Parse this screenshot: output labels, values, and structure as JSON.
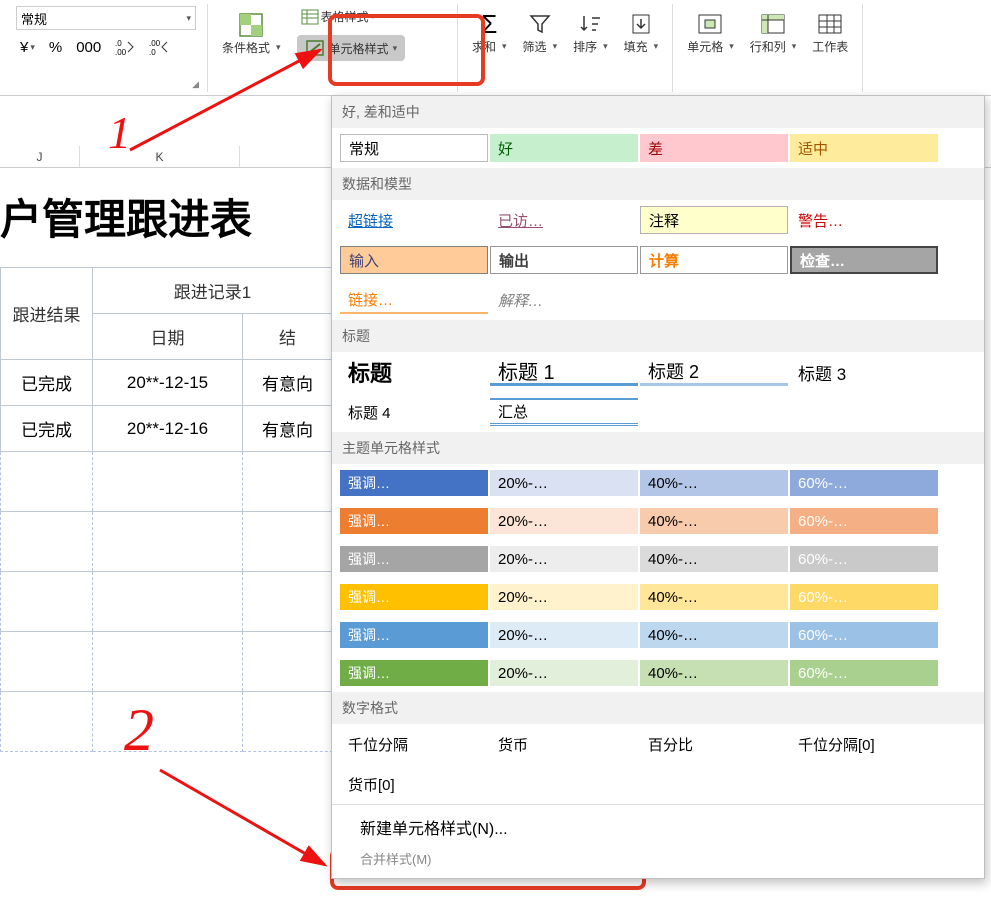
{
  "ribbon": {
    "number_format": "常规",
    "currency_btn": "¥",
    "percent_btn": "%",
    "thousand_btn": "000",
    "dec_inc": ".0 0",
    "dec_dec": ".00",
    "cond_format": "条件格式",
    "table_styles": "表格样式",
    "cell_styles": "单元格样式",
    "sum": "求和",
    "filter": "筛选",
    "sort": "排序",
    "fill": "填充",
    "cells": "单元格",
    "rowcol": "行和列",
    "worksheet": "工作表"
  },
  "columns": {
    "j": "J",
    "k": "K"
  },
  "sheet": {
    "title": "户管理跟进表",
    "headers": {
      "result": "跟进结果",
      "record": "跟进记录1",
      "date": "日期",
      "detail": "结"
    },
    "rows": [
      {
        "result": "已完成",
        "date": "20**-12-15",
        "detail": "有意向"
      },
      {
        "result": "已完成",
        "date": "20**-12-16",
        "detail": "有意向"
      }
    ]
  },
  "gallery": {
    "sec1": "好, 差和适中",
    "normal": "常规",
    "good": "好",
    "bad": "差",
    "neutral": "适中",
    "sec2": "数据和模型",
    "hyperlink": "超链接",
    "visited": "已访…",
    "note": "注释",
    "warning": "警告…",
    "input": "输入",
    "output": "输出",
    "calc": "计算",
    "check": "检查…",
    "link": "链接…",
    "explain": "解释…",
    "sec3": "标题",
    "heading": "标题",
    "h1": "标题 1",
    "h2": "标题 2",
    "h3": "标题 3",
    "h4": "标题 4",
    "summary": "汇总",
    "sec4": "主题单元格样式",
    "emph": "强调…",
    "p20": "20%-…",
    "p40": "40%-…",
    "p60": "60%-…",
    "sec5": "数字格式",
    "thousand": "千位分隔",
    "currency": "货币",
    "percent": "百分比",
    "thousand0": "千位分隔[0]",
    "currency0": "货币[0]",
    "new_style": "新建单元格样式(N)...",
    "merge_style": "合并样式(M)"
  },
  "anno": {
    "one": "1",
    "two": "2"
  }
}
